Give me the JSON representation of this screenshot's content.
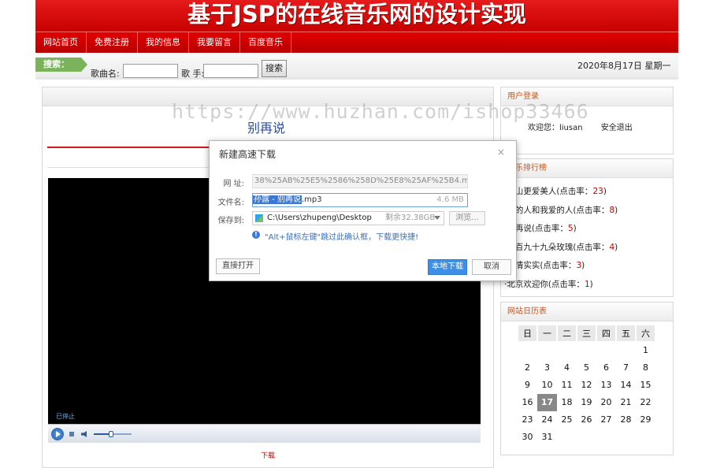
{
  "banner": {
    "title": "基于JSP的在线音乐网的设计实现"
  },
  "nav": {
    "items": [
      "网站首页",
      "免费注册",
      "我的信息",
      "我要留言",
      "百度音乐"
    ]
  },
  "search": {
    "tag": "搜索：",
    "song_label": "歌曲名:",
    "song_value": "",
    "singer_label": "歌 手:",
    "singer_value": "",
    "button": "搜索",
    "date": "2020年8月17日 星期一"
  },
  "player": {
    "song_title": "别再说",
    "status": "已停止",
    "volume_level": 0.45,
    "download": "下载"
  },
  "login": {
    "heading": "用户登录",
    "welcome": "欢迎您：liusan",
    "logout": "安全退出"
  },
  "ranking": {
    "heading": "音乐排行榜",
    "items": [
      {
        "name": "·江山更爱美人(点击率：",
        "count": "23",
        "tail": ")"
      },
      {
        "name": "·我的人和我爱的人(点击率：",
        "count": "8",
        "tail": ")"
      },
      {
        "name": "·别再说(点击率：",
        "count": "5",
        "tail": ")"
      },
      {
        "name": "·九百九十九朵玫瑰(点击率：",
        "count": "4",
        "tail": ")"
      },
      {
        "name": "·真情实实(点击率：",
        "count": "3",
        "tail": ")"
      },
      {
        "name": "·北京欢迎你(点击率：",
        "count": "1",
        "tail": ")"
      }
    ]
  },
  "calendar": {
    "heading": "网站日历表",
    "weekdays": [
      "日",
      "一",
      "二",
      "三",
      "四",
      "五",
      "六"
    ],
    "weeks": [
      [
        "",
        "",
        "",
        "",
        "",
        "",
        "1"
      ],
      [
        "2",
        "3",
        "4",
        "5",
        "6",
        "7",
        "8"
      ],
      [
        "9",
        "10",
        "11",
        "12",
        "13",
        "14",
        "15"
      ],
      [
        "16",
        "17",
        "18",
        "19",
        "20",
        "21",
        "22"
      ],
      [
        "23",
        "24",
        "25",
        "26",
        "27",
        "28",
        "29"
      ],
      [
        "30",
        "31",
        "",
        "",
        "",
        "",
        ""
      ]
    ],
    "today": "17"
  },
  "dialog": {
    "title": "新建高速下载",
    "close": "×",
    "url_label": "网 址:",
    "url_value": "38%25AB%25E5%2586%258D%25E8%25AF%25B4.mp3",
    "file_label": "文件名:",
    "file_selected": "孙露 - 别再说",
    "file_ext": ".mp3",
    "file_size": "4.6 MB",
    "save_label": "保存到:",
    "save_path": "C:\\Users\\zhupeng\\Desktop",
    "save_free": "剩余32.38GB",
    "browse": "浏览...",
    "tip": "\"Alt+鼠标左键\"跳过此确认框，下载更快捷!",
    "open_btn": "直接打开",
    "download_btn": "本地下载",
    "cancel_btn": "取消"
  },
  "watermark": "https://www.huzhan.com/ishop33466"
}
